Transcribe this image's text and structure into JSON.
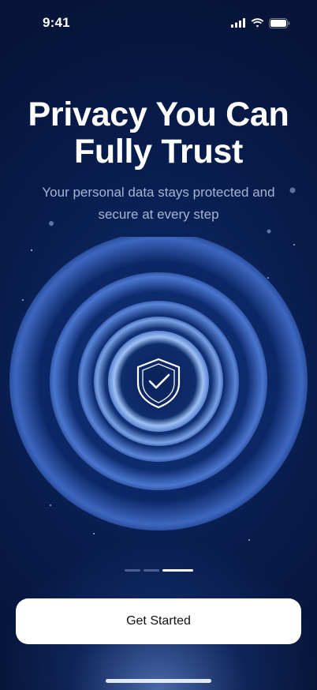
{
  "status_bar": {
    "time": "9:41",
    "icons": [
      "cellular-signal-icon",
      "wifi-icon",
      "battery-icon"
    ]
  },
  "hero": {
    "title_line_1": "Privacy You Can",
    "title_line_2": "Fully Trust",
    "subtitle_line_1": "Your personal data stays protected and",
    "subtitle_line_2": "secure at every step"
  },
  "illustration": {
    "icon": "shield-check-icon"
  },
  "pager": {
    "pages": 3,
    "active_index": 2
  },
  "cta": {
    "label": "Get Started"
  },
  "colors": {
    "background": "#061437",
    "accent_glow": "#8fb4ff",
    "button": "#ffffff",
    "text": "#ffffff"
  }
}
